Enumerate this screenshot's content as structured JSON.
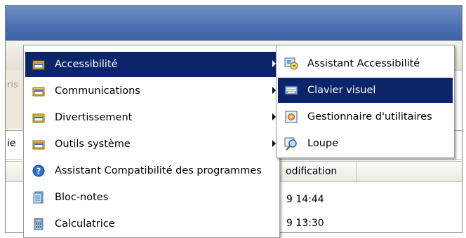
{
  "background": {
    "left_fragments": [
      "ris",
      "ie"
    ],
    "column_header": "odification",
    "list_values": [
      "9 14:44",
      "9 13:30"
    ]
  },
  "menu": {
    "items": [
      {
        "label": "Accessibilité",
        "icon": "program-group-icon",
        "submenu": true,
        "selected": true
      },
      {
        "label": "Communications",
        "icon": "program-group-icon",
        "submenu": true,
        "selected": false
      },
      {
        "label": "Divertissement",
        "icon": "program-group-icon",
        "submenu": true,
        "selected": false
      },
      {
        "label": "Outils système",
        "icon": "program-group-icon",
        "submenu": true,
        "selected": false
      },
      {
        "label": "Assistant Compatibilité des programmes",
        "icon": "help-icon",
        "submenu": false,
        "selected": false
      },
      {
        "label": "Bloc-notes",
        "icon": "notepad-icon",
        "submenu": false,
        "selected": false
      },
      {
        "label": "Calculatrice",
        "icon": "calculator-icon",
        "submenu": false,
        "selected": false
      }
    ]
  },
  "submenu": {
    "items": [
      {
        "label": "Assistant Accessibilité",
        "icon": "accessibility-wizard-icon",
        "selected": false
      },
      {
        "label": "Clavier visuel",
        "icon": "keyboard-icon",
        "selected": true
      },
      {
        "label": "Gestionnaire d'utilitaires",
        "icon": "utility-manager-icon",
        "selected": false
      },
      {
        "label": "Loupe",
        "icon": "magnifier-icon",
        "selected": false
      }
    ]
  },
  "colors": {
    "selection": "#0b246a",
    "titlebar": "#4e72b3"
  }
}
